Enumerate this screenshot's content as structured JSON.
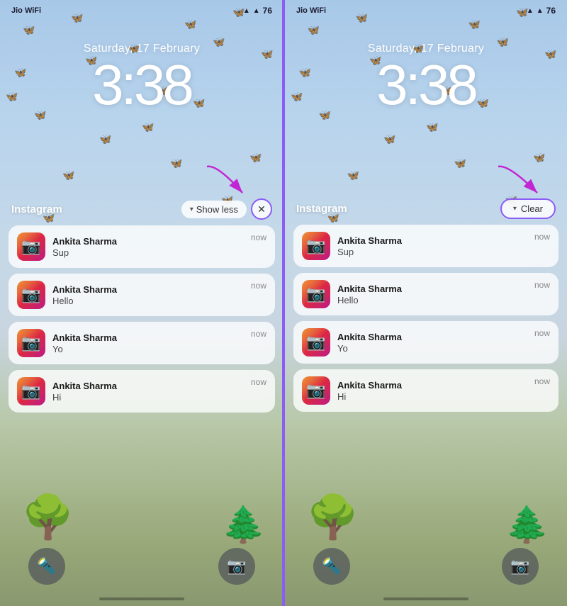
{
  "panels": [
    {
      "id": "left-panel",
      "status": {
        "carrier": "Jio WiFi",
        "wifi": "wifi",
        "battery": "76"
      },
      "date": "Saturday, 17 February",
      "time": "3:38",
      "notifications": {
        "app_name": "Instagram",
        "action_label": "Show less",
        "close_label": "✕",
        "items": [
          {
            "sender": "Ankita Sharma",
            "message": "Sup",
            "time": "now"
          },
          {
            "sender": "Ankita Sharma",
            "message": "Hello",
            "time": "now"
          },
          {
            "sender": "Ankita Sharma",
            "message": "Yo",
            "time": "now"
          },
          {
            "sender": "Ankita Sharma",
            "message": "Hi",
            "time": "now"
          }
        ]
      }
    },
    {
      "id": "right-panel",
      "status": {
        "carrier": "Jio WiFi",
        "wifi": "wifi",
        "battery": "76"
      },
      "date": "Saturday, 17 February",
      "time": "3:38",
      "notifications": {
        "app_name": "Instagram",
        "action_label": "Clear",
        "items": [
          {
            "sender": "Ankita Sharma",
            "message": "Sup",
            "time": "now"
          },
          {
            "sender": "Ankita Sharma",
            "message": "Hello",
            "time": "now"
          },
          {
            "sender": "Ankita Sharma",
            "message": "Yo",
            "time": "now"
          },
          {
            "sender": "Ankita Sharma",
            "message": "Hi",
            "time": "now"
          }
        ]
      }
    }
  ],
  "butterflies": [
    "🦋",
    "🦋",
    "🦋",
    "🦋",
    "🦋",
    "🦋",
    "🦋",
    "🦋",
    "🦋",
    "🦋",
    "🦋",
    "🦋",
    "🦋",
    "🦋",
    "🦋",
    "🦋",
    "🦋",
    "🦋",
    "🦋",
    "🦋"
  ]
}
